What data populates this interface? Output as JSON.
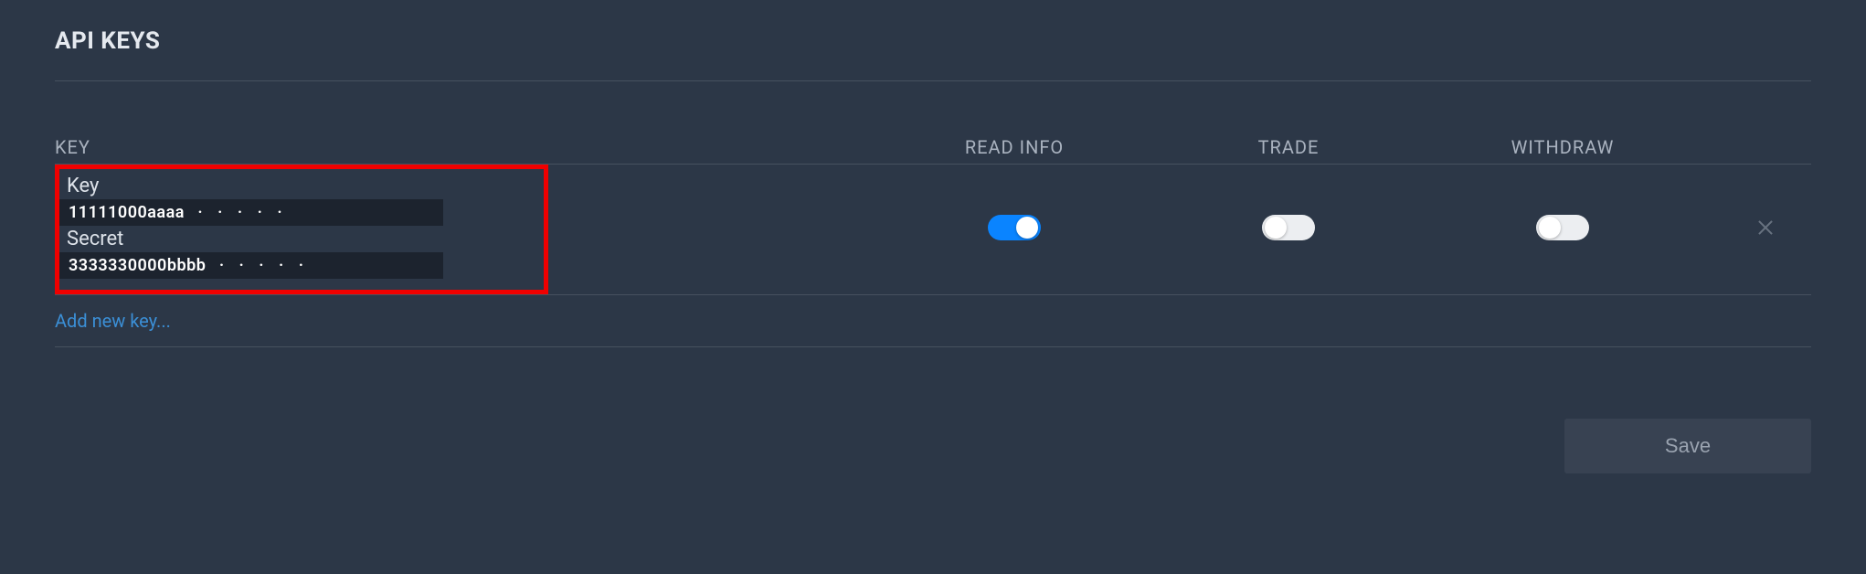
{
  "title": "API KEYS",
  "columns": {
    "key": "KEY",
    "read_info": "READ INFO",
    "trade": "TRADE",
    "withdraw": "WITHDRAW"
  },
  "row": {
    "key_label": "Key",
    "key_value": "11111000aaaa",
    "key_dots": " ·  ·  ·  ·  · ",
    "secret_label": "Secret",
    "secret_value": "3333330000bbbb",
    "secret_dots": " ·  ·  ·  ·  · ",
    "read_info_on": true,
    "trade_on": false,
    "withdraw_on": false
  },
  "add_new_label": "Add new key...",
  "save_label": "Save"
}
